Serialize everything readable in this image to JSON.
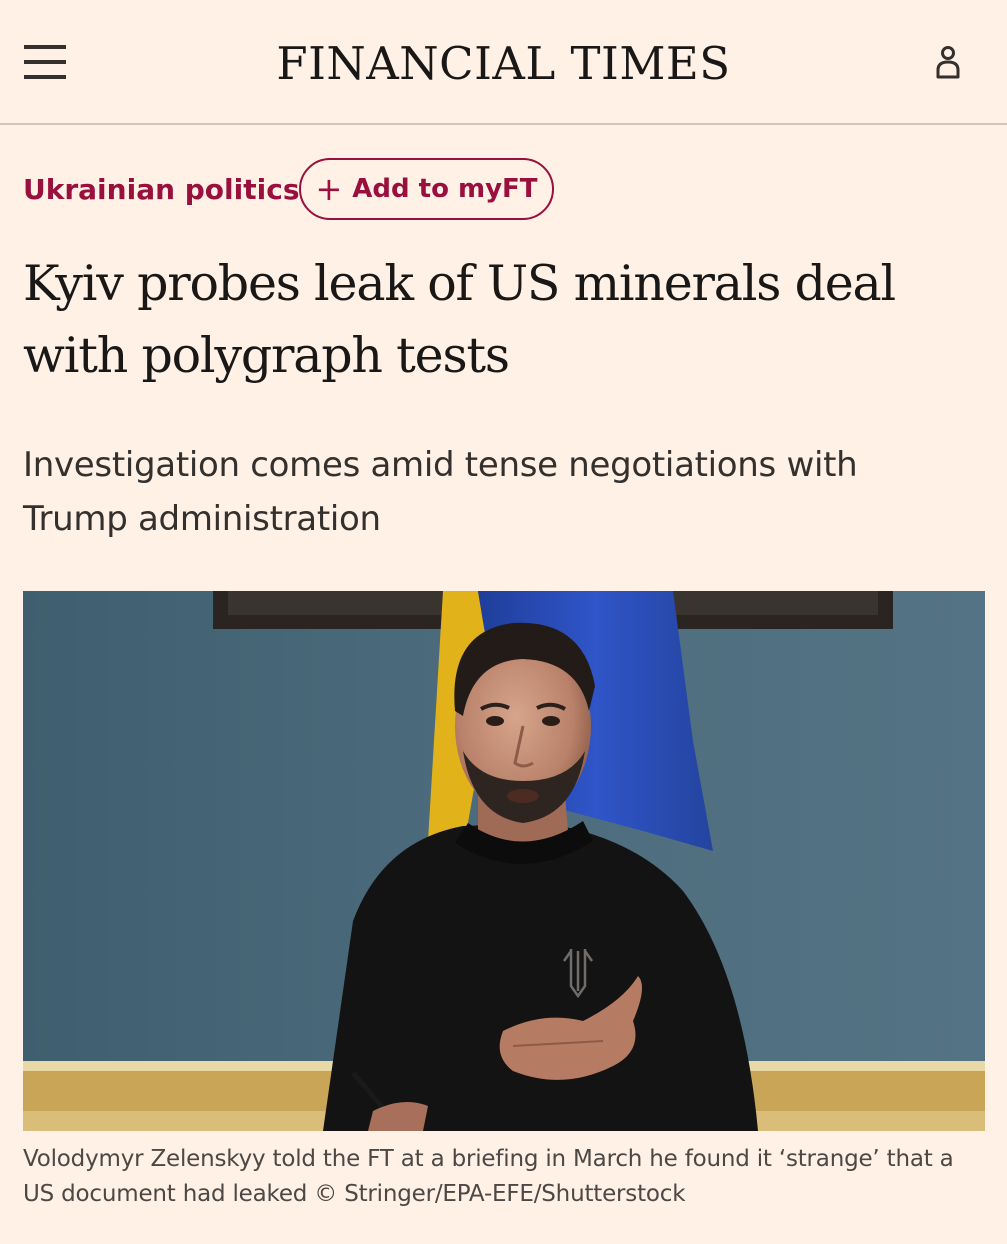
{
  "header": {
    "masthead": "FINANCIAL TIMES",
    "menu_icon": "hamburger-menu-icon",
    "account_icon": "user-account-icon"
  },
  "article": {
    "topic": "Ukrainian politics",
    "myft_button": {
      "plus": "+",
      "label": "Add to myFT"
    },
    "headline": "Kyiv probes leak of US minerals deal with polygraph tests",
    "standfirst": "Investigation comes amid tense negotiations with Trump administration",
    "caption": "Volodymyr Zelenskyy told the FT at a briefing in March he found it ‘strange’ that a US document had leaked © Stringer/EPA-EFE/Shutterstock"
  },
  "colors": {
    "background": "#fff1e5",
    "claret": "#990f3d",
    "text": "#1a1817"
  }
}
